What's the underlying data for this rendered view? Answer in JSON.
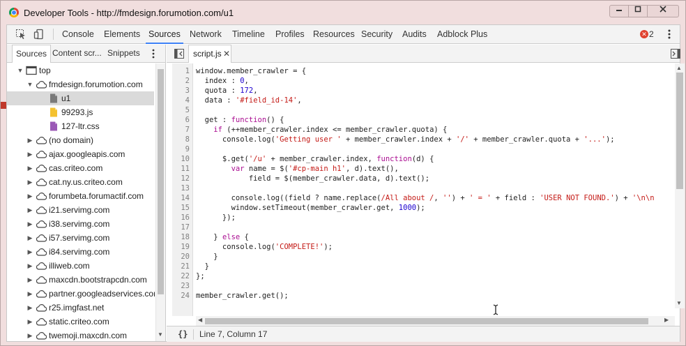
{
  "window": {
    "title": "Developer Tools - http://fmdesign.forumotion.com/u1",
    "controls": {
      "minimize": "min",
      "maximize": "max",
      "close": "close"
    }
  },
  "toolbar": {
    "tabs": [
      {
        "label": "Console",
        "active": false
      },
      {
        "label": "Elements",
        "active": false
      },
      {
        "label": "Sources",
        "active": true
      },
      {
        "label": "Network",
        "active": false
      },
      {
        "label": "Timeline",
        "active": false
      },
      {
        "label": "Profiles",
        "active": false
      },
      {
        "label": "Resources",
        "active": false
      },
      {
        "label": "Security",
        "active": false
      },
      {
        "label": "Audits",
        "active": false
      },
      {
        "label": "Adblock Plus",
        "active": false
      }
    ],
    "error_count": "2",
    "accent_color": "#3e82f7",
    "error_color": "#e0422f"
  },
  "navigator": {
    "tabs": [
      {
        "label": "Sources",
        "active": true
      },
      {
        "label": "Content scr...",
        "active": false
      },
      {
        "label": "Snippets",
        "active": false
      }
    ],
    "tree": [
      {
        "label": "top",
        "icon": "frame-icon",
        "depth": 0,
        "expanded": true
      },
      {
        "label": "fmdesign.forumotion.com",
        "icon": "cloud-icon",
        "depth": 1,
        "expanded": true
      },
      {
        "label": "u1",
        "icon": "document-icon",
        "depth": 2,
        "selected": true,
        "file_color": "#7a7a7a"
      },
      {
        "label": "99293.js",
        "icon": "js-file-icon",
        "depth": 2,
        "file_color": "#f4c230"
      },
      {
        "label": "127-ltr.css",
        "icon": "css-file-icon",
        "depth": 2,
        "file_color": "#9b59b6"
      },
      {
        "label": "(no domain)",
        "icon": "cloud-icon",
        "depth": 1
      },
      {
        "label": "ajax.googleapis.com",
        "icon": "cloud-icon",
        "depth": 1
      },
      {
        "label": "cas.criteo.com",
        "icon": "cloud-icon",
        "depth": 1
      },
      {
        "label": "cat.ny.us.criteo.com",
        "icon": "cloud-icon",
        "depth": 1
      },
      {
        "label": "forumbeta.forumactif.com",
        "icon": "cloud-icon",
        "depth": 1
      },
      {
        "label": "i21.servimg.com",
        "icon": "cloud-icon",
        "depth": 1
      },
      {
        "label": "i38.servimg.com",
        "icon": "cloud-icon",
        "depth": 1
      },
      {
        "label": "i57.servimg.com",
        "icon": "cloud-icon",
        "depth": 1
      },
      {
        "label": "i84.servimg.com",
        "icon": "cloud-icon",
        "depth": 1
      },
      {
        "label": "illiweb.com",
        "icon": "cloud-icon",
        "depth": 1
      },
      {
        "label": "maxcdn.bootstrapcdn.com",
        "icon": "cloud-icon",
        "depth": 1
      },
      {
        "label": "partner.googleadservices.com",
        "icon": "cloud-icon",
        "depth": 1
      },
      {
        "label": "r25.imgfast.net",
        "icon": "cloud-icon",
        "depth": 1
      },
      {
        "label": "static.criteo.com",
        "icon": "cloud-icon",
        "depth": 1
      },
      {
        "label": "twemoji.maxcdn.com",
        "icon": "cloud-icon",
        "depth": 1
      }
    ]
  },
  "editor": {
    "open_file": "script.js",
    "lines": [
      [
        [
          "window.member_crawler = {",
          "p"
        ]
      ],
      [
        [
          "  index : ",
          "p"
        ],
        [
          "0",
          "n"
        ],
        [
          ",",
          "p"
        ]
      ],
      [
        [
          "  quota : ",
          "p"
        ],
        [
          "172",
          "n"
        ],
        [
          ",",
          "p"
        ]
      ],
      [
        [
          "  data : ",
          "p"
        ],
        [
          "'#field_id-14'",
          "s"
        ],
        [
          ",",
          "p"
        ]
      ],
      [
        [
          "",
          "p"
        ]
      ],
      [
        [
          "  get : ",
          "p"
        ],
        [
          "function",
          "k"
        ],
        [
          "() {",
          "p"
        ]
      ],
      [
        [
          "    ",
          "p"
        ],
        [
          "if",
          "k"
        ],
        [
          " (++member_crawler.index <= member_crawler.quota) {",
          "p"
        ]
      ],
      [
        [
          "      console.log(",
          "p"
        ],
        [
          "'Getting user '",
          "s"
        ],
        [
          " + member_crawler.index + ",
          "p"
        ],
        [
          "'/'",
          "s"
        ],
        [
          " + member_crawler.quota + ",
          "p"
        ],
        [
          "'...'",
          "s"
        ],
        [
          ");",
          "p"
        ]
      ],
      [
        [
          "",
          "p"
        ]
      ],
      [
        [
          "      $.get(",
          "p"
        ],
        [
          "'/u'",
          "s"
        ],
        [
          " + member_crawler.index, ",
          "p"
        ],
        [
          "function",
          "k"
        ],
        [
          "(d) {",
          "p"
        ]
      ],
      [
        [
          "        ",
          "p"
        ],
        [
          "var",
          "k"
        ],
        [
          " name = $(",
          "p"
        ],
        [
          "'#cp-main h1'",
          "s"
        ],
        [
          ", d).text(),",
          "p"
        ]
      ],
      [
        [
          "            field = $(member_crawler.data, d).text();",
          "p"
        ]
      ],
      [
        [
          "",
          "p"
        ]
      ],
      [
        [
          "        console.log((field ? name.replace(",
          "p"
        ],
        [
          "/All about /",
          "s"
        ],
        [
          ", ",
          "p"
        ],
        [
          "''",
          "s"
        ],
        [
          ") + ",
          "p"
        ],
        [
          "' = '",
          "s"
        ],
        [
          " + field : ",
          "p"
        ],
        [
          "'USER NOT FOUND.'",
          "s"
        ],
        [
          ") + ",
          "p"
        ],
        [
          "'\\n\\n",
          "s"
        ]
      ],
      [
        [
          "        window.setTimeout(member_crawler.get, ",
          "p"
        ],
        [
          "1000",
          "n"
        ],
        [
          ");",
          "p"
        ]
      ],
      [
        [
          "      });",
          "p"
        ]
      ],
      [
        [
          "",
          "p"
        ]
      ],
      [
        [
          "    } ",
          "p"
        ],
        [
          "else",
          "k"
        ],
        [
          " {",
          "p"
        ]
      ],
      [
        [
          "      console.log(",
          "p"
        ],
        [
          "'COMPLETE!'",
          "s"
        ],
        [
          ");",
          "p"
        ]
      ],
      [
        [
          "    }",
          "p"
        ]
      ],
      [
        [
          "  }",
          "p"
        ]
      ],
      [
        [
          "};",
          "p"
        ]
      ],
      [
        [
          "",
          "p"
        ]
      ],
      [
        [
          "member_crawler.get();",
          "p"
        ]
      ]
    ],
    "status": {
      "pretty_print": "{}",
      "cursor_position": "Line 7, Column 17"
    },
    "syntax_colors": {
      "keyword": "#aa0d91",
      "number": "#1c00cf",
      "string": "#c41a16"
    }
  }
}
